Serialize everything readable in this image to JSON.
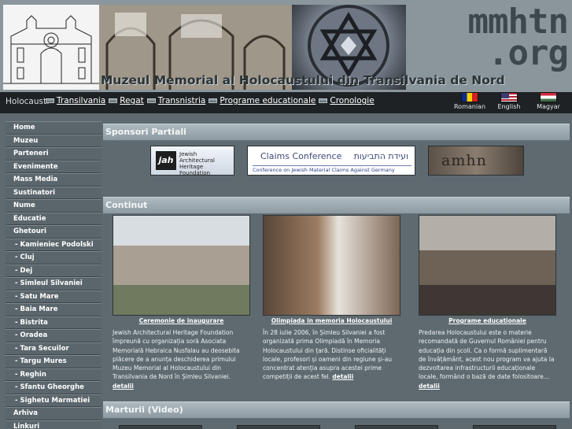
{
  "header": {
    "domain": "mmhtn .org",
    "title": "Muzeul Memorial al Holocaustului din Transilvania de Nord"
  },
  "nav": {
    "label": "Holocaust:",
    "links": [
      "Transilvania",
      "Regat",
      "Transnistria",
      "Programe educationale",
      "Cronologie"
    ]
  },
  "languages": [
    {
      "label": "Romanian",
      "flag": "flag-romania-icon"
    },
    {
      "label": "English",
      "flag": "flag-usa-icon"
    },
    {
      "label": "Magyar",
      "flag": "flag-hungary-icon"
    }
  ],
  "sidebar": {
    "items": [
      {
        "label": "Home",
        "sub": false
      },
      {
        "label": "Muzeu",
        "sub": false
      },
      {
        "label": "Parteneri",
        "sub": false
      },
      {
        "label": "Evenimente",
        "sub": false
      },
      {
        "label": "Mass Media",
        "sub": false
      },
      {
        "label": "Sustinatori",
        "sub": false
      },
      {
        "label": "Nume",
        "sub": false
      },
      {
        "label": "Educatie",
        "sub": false
      },
      {
        "label": "Ghetouri",
        "sub": false
      },
      {
        "label": "- Kamieniec Podolski",
        "sub": true
      },
      {
        "label": "- Cluj",
        "sub": true
      },
      {
        "label": "- Dej",
        "sub": true
      },
      {
        "label": "- Simleul Silvaniei",
        "sub": true
      },
      {
        "label": "- Satu Mare",
        "sub": true
      },
      {
        "label": "- Baia Mare",
        "sub": true
      },
      {
        "label": "- Bistrita",
        "sub": true
      },
      {
        "label": "- Oradea",
        "sub": true
      },
      {
        "label": "- Tara Secuilor",
        "sub": true
      },
      {
        "label": "- Targu Mures",
        "sub": true
      },
      {
        "label": "- Reghin",
        "sub": true
      },
      {
        "label": "- Sfantu Gheorghe",
        "sub": true
      },
      {
        "label": "- Sighetu Marmatiei",
        "sub": true
      },
      {
        "label": "Arhiva",
        "sub": false
      },
      {
        "label": "Linkuri",
        "sub": false
      }
    ]
  },
  "sections": {
    "sponsors": "Sponsori Partiali",
    "content": "Continut",
    "video": "Marturii (Video)"
  },
  "sponsors": {
    "jahf": {
      "mark": "jah",
      "text": "Jewish Architectural Heritage Foundation"
    },
    "claims": {
      "title": "Claims Conference",
      "hebrew": "ועידת התביעות",
      "sub": "Conference on Jewish Material Claims Against Germany"
    },
    "amhn": {
      "text": "amhn"
    }
  },
  "columns": [
    {
      "title": "Ceremonie de inaugurare",
      "text": "Jewish Architectural Heritage Foundation împreună cu organizația soră Asociata Memorială Hebraica Nusfalau au deosebita plăcere de a anunța deschiderea primului Muzeu Memorial al Holocaustului din Transilvania de Nord în Șimleu Silvaniei.",
      "link": "detalii"
    },
    {
      "title": "Olimpiada in memoria Holocaustului",
      "text": "În 28 iulie 2006, în Șimleu Silvaniei a fost organizată prima Olimpiadă în Memoria Holocaustului din țară. Distinse oficialități locale, profesori și oameni din regiune și-au concentrat atenția asupra acestei prime competiții de acest fel.",
      "link": "detalii"
    },
    {
      "title": "Programe educationale",
      "text": "Predarea Holocaustului este o materie recomandată de Guvernul României pentru educația din școli. Ca o formă suplimentară de învățământ, acest nou program va ajuta la dezvoltarea infrastructurii educaționale locale, formând o bază de date folositoare...",
      "link": "detalii"
    }
  ]
}
